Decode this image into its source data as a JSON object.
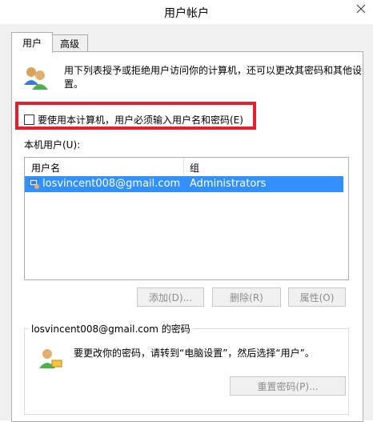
{
  "window": {
    "title": "用户帐户",
    "close_glyph": "✕"
  },
  "tabs": [
    {
      "label": "用户",
      "active": true
    },
    {
      "label": "高级",
      "active": false
    }
  ],
  "description": "用下列表授予或拒绝用户访问你的计算机，还可以更改其密码和其他设置。",
  "require_login": {
    "label": "要使用本计算机，用户必须输入用户名和密码(E)",
    "checked": false
  },
  "local_users_label": "本机用户(U):",
  "users_table": {
    "columns": [
      "用户名",
      "组"
    ],
    "rows": [
      {
        "username": "losvincent008@gmail.com",
        "group": "Administrators",
        "selected": true
      }
    ]
  },
  "buttons": {
    "add": "添加(D)...",
    "delete": "删除(R)",
    "properties": "属性(O)",
    "reset_password": "重置密码(P)..."
  },
  "password_group": {
    "title": "losvincent008@gmail.com 的密码",
    "text": "要更改你的密码，请转到“电脑设置”，然后选择“用户”。"
  },
  "colors": {
    "highlight": "#e5202e",
    "selection": "#3390ff"
  }
}
